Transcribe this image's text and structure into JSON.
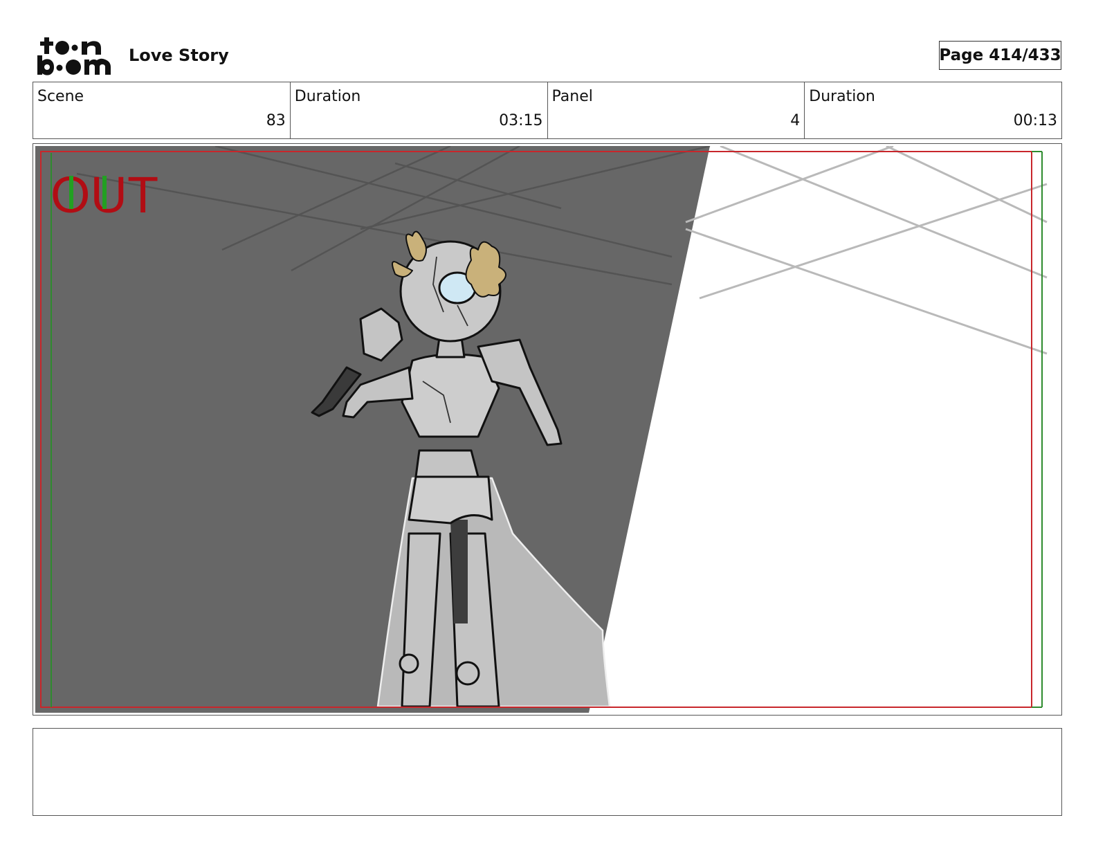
{
  "header": {
    "logo_text_line1": "toon",
    "logo_text_line2": "boom",
    "project_title": "Love Story",
    "page_label": "Page 414/433"
  },
  "info": {
    "scene_label": "Scene",
    "scene_value": "83",
    "scene_duration_label": "Duration",
    "scene_duration_value": "03:15",
    "panel_label": "Panel",
    "panel_value": "4",
    "panel_duration_label": "Duration",
    "panel_duration_value": "00:13"
  },
  "panel_image": {
    "overlay_text": "OUT",
    "overlay_color": "#b10d14",
    "safe_area_color": "#c8262b",
    "frame_line_color": "#2e8b2e",
    "shadow_color": "#676767",
    "hair_color": "#c9b17a",
    "eye_color": "#cfe8f4"
  },
  "caption": {
    "text": ""
  }
}
